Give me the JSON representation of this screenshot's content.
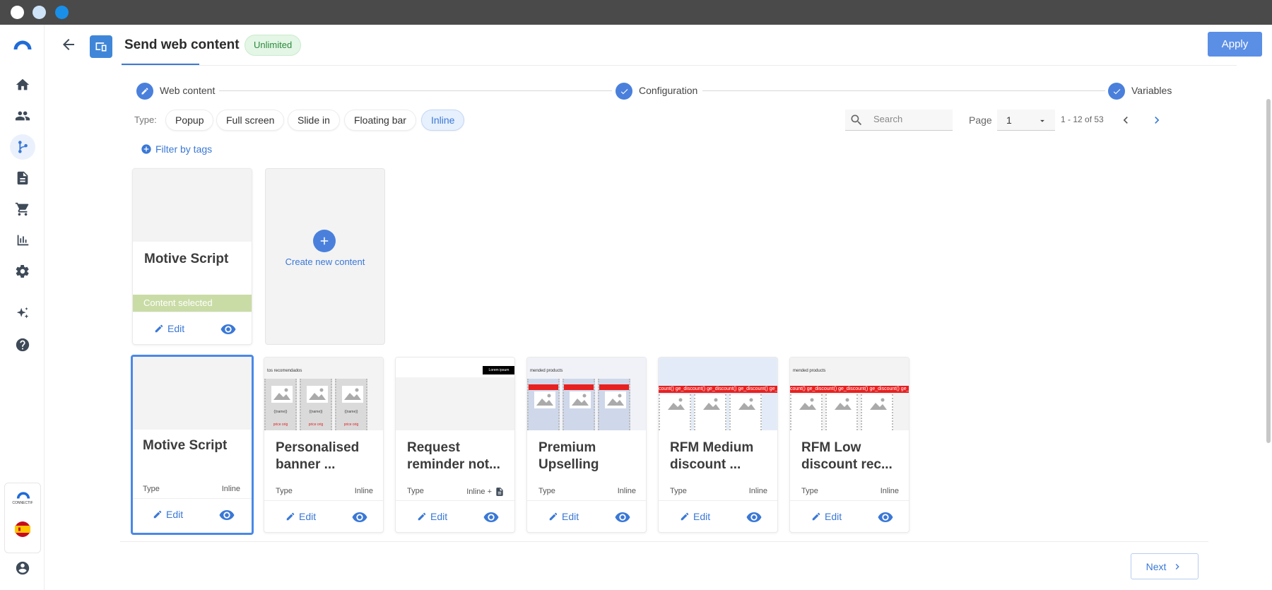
{
  "header": {
    "title": "Send web content",
    "badge": "Unlimited",
    "apply_label": "Apply"
  },
  "sidebar": {
    "items": [
      {
        "icon": "home-icon"
      },
      {
        "icon": "users-icon"
      },
      {
        "icon": "flow-icon",
        "active": true
      },
      {
        "icon": "document-icon"
      },
      {
        "icon": "cart-icon"
      },
      {
        "icon": "chart-icon"
      },
      {
        "icon": "gear-icon"
      },
      {
        "icon": "sparkle-icon"
      },
      {
        "icon": "help-icon"
      }
    ],
    "brand": "CONNECTIF"
  },
  "stepper": {
    "steps": [
      {
        "label": "Web content",
        "state": "edit"
      },
      {
        "label": "Configuration",
        "state": "done"
      },
      {
        "label": "Variables",
        "state": "done"
      }
    ]
  },
  "filters": {
    "type_label": "Type:",
    "types": [
      "Popup",
      "Full screen",
      "Slide in",
      "Floating bar",
      "Inline"
    ],
    "active_type": "Inline",
    "filter_tags_label": "Filter by tags",
    "search_placeholder": "Search",
    "page_label": "Page",
    "page_value": "1",
    "page_count": "1 - 12 of 53"
  },
  "selected_card": {
    "title": "Motive Script",
    "status": "Content selected",
    "edit_label": "Edit"
  },
  "create_card": {
    "label": "Create new content"
  },
  "cards": [
    {
      "title": "Motive Script",
      "type_label": "Type",
      "type_value": "Inline",
      "edit_label": "Edit",
      "thumb": "blank"
    },
    {
      "title": "Personalised banner ...",
      "type_label": "Type",
      "type_value": "Inline",
      "edit_label": "Edit",
      "thumb": "products",
      "thumb_heading": "tos recomendados"
    },
    {
      "title": "Request reminder not...",
      "type_label": "Type",
      "type_value": "Inline +",
      "edit_label": "Edit",
      "thumb": "dark-button",
      "thumb_button": "Lorem ipsum"
    },
    {
      "title": "Premium Upselling",
      "type_label": "Type",
      "type_value": "Inline",
      "edit_label": "Edit",
      "thumb": "products-red",
      "thumb_heading": "mended products"
    },
    {
      "title": "RFM Medium discount ...",
      "type_label": "Type",
      "type_value": "Inline",
      "edit_label": "Edit",
      "thumb": "discount",
      "thumb_band": "count() ge_discount() ge_discount() ge_discount() ge_discount()"
    },
    {
      "title": "RFM Low discount rec...",
      "type_label": "Type",
      "type_value": "Inline",
      "edit_label": "Edit",
      "thumb": "discount",
      "thumb_heading": "mended products",
      "thumb_band": "count() ge_discount() ge_discount() ge_discount() ge_discount()"
    }
  ],
  "footer": {
    "next_label": "Next"
  },
  "colors": {
    "accent": "#3a78d6",
    "badge_bg": "#e4f6e6",
    "selected_bar": "#c9dca6",
    "titlebar": "#4a4a4a"
  }
}
